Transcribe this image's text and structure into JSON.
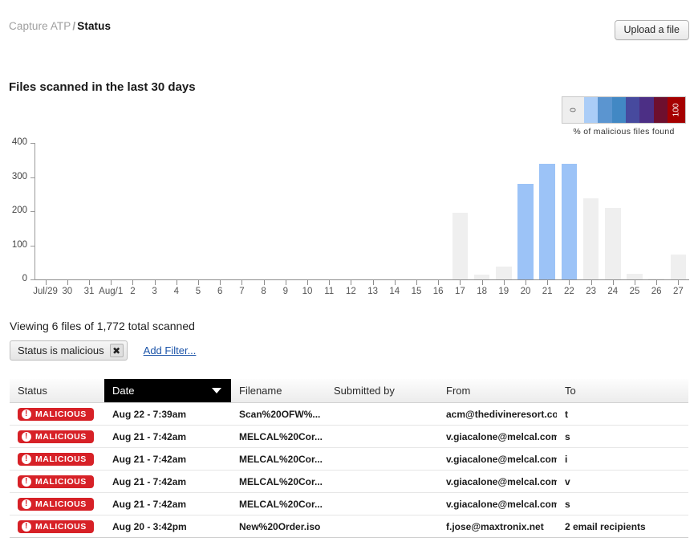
{
  "breadcrumb": {
    "parent": "Capture ATP",
    "separator": "/",
    "current": "Status"
  },
  "toolbar": {
    "upload_label": "Upload a file"
  },
  "chart_title": "Files scanned in the last 30 days",
  "legend": {
    "caption": "% of malicious files found",
    "min_label": "0",
    "max_label": "100",
    "colors": [
      "#eeeeee",
      "#abcdf7",
      "#5b95d0",
      "#4288c4",
      "#474a9e",
      "#4c2f85",
      "#6e0f2e",
      "#a50000"
    ]
  },
  "summary": {
    "text": "Viewing 6 files of 1,772 total scanned"
  },
  "filters": {
    "chip_label": "Status is malicious",
    "chip_remove_icon": "close-icon",
    "add_filter_label": "Add Filter..."
  },
  "table": {
    "columns": [
      {
        "label": "Status",
        "active": false
      },
      {
        "label": "Date",
        "active": true
      },
      {
        "label": "Filename",
        "active": false
      },
      {
        "label": "Submitted by",
        "active": false
      },
      {
        "label": "From",
        "active": false
      },
      {
        "label": "To",
        "active": false
      }
    ],
    "rows": [
      {
        "status": "MALICIOUS",
        "date": "Aug 22 - 7:39am",
        "filename": "Scan%20OFW%...",
        "submitted_by": "",
        "from": "acm@thedivineresort.co...",
        "to": "t"
      },
      {
        "status": "MALICIOUS",
        "date": "Aug 21 - 7:42am",
        "filename": "MELCAL%20Cor...",
        "submitted_by": "",
        "from": "v.giacalone@melcal.com",
        "to": "s"
      },
      {
        "status": "MALICIOUS",
        "date": "Aug 21 - 7:42am",
        "filename": "MELCAL%20Cor...",
        "submitted_by": "",
        "from": "v.giacalone@melcal.com",
        "to": "i"
      },
      {
        "status": "MALICIOUS",
        "date": "Aug 21 - 7:42am",
        "filename": "MELCAL%20Cor...",
        "submitted_by": "",
        "from": "v.giacalone@melcal.com",
        "to": "v"
      },
      {
        "status": "MALICIOUS",
        "date": "Aug 21 - 7:42am",
        "filename": "MELCAL%20Cor...",
        "submitted_by": "",
        "from": "v.giacalone@melcal.com",
        "to": "s"
      },
      {
        "status": "MALICIOUS",
        "date": "Aug 20 - 3:42pm",
        "filename": "New%20Order.iso",
        "submitted_by": "",
        "from": "f.jose@maxtronix.net",
        "to": "2 email recipients"
      }
    ]
  },
  "chart_data": {
    "type": "bar",
    "title": "Files scanned in the last 30 days",
    "xlabel": "",
    "ylabel": "",
    "ylim": [
      0,
      400
    ],
    "yticks": [
      0,
      100,
      200,
      300,
      400
    ],
    "grid": false,
    "legend_position": "top-right",
    "categories": [
      "Jul/29",
      "30",
      "31",
      "Aug/1",
      "2",
      "3",
      "4",
      "5",
      "6",
      "7",
      "8",
      "9",
      "10",
      "11",
      "12",
      "13",
      "14",
      "15",
      "16",
      "17",
      "18",
      "19",
      "20",
      "21",
      "22",
      "23",
      "24",
      "25",
      "26",
      "27"
    ],
    "values": [
      0,
      0,
      0,
      0,
      0,
      0,
      0,
      0,
      0,
      0,
      0,
      0,
      0,
      0,
      0,
      0,
      0,
      0,
      0,
      196,
      15,
      37,
      279,
      340,
      340,
      237,
      210,
      17,
      3,
      72
    ],
    "bar_colors": [
      "#efefef",
      "#efefef",
      "#efefef",
      "#efefef",
      "#efefef",
      "#efefef",
      "#efefef",
      "#efefef",
      "#efefef",
      "#efefef",
      "#efefef",
      "#efefef",
      "#efefef",
      "#efefef",
      "#efefef",
      "#efefef",
      "#efefef",
      "#efefef",
      "#efefef",
      "#efefef",
      "#efefef",
      "#efefef",
      "#9cc3f7",
      "#9cc3f7",
      "#9cc3f7",
      "#efefef",
      "#efefef",
      "#efefef",
      "#efefef",
      "#efefef"
    ]
  }
}
